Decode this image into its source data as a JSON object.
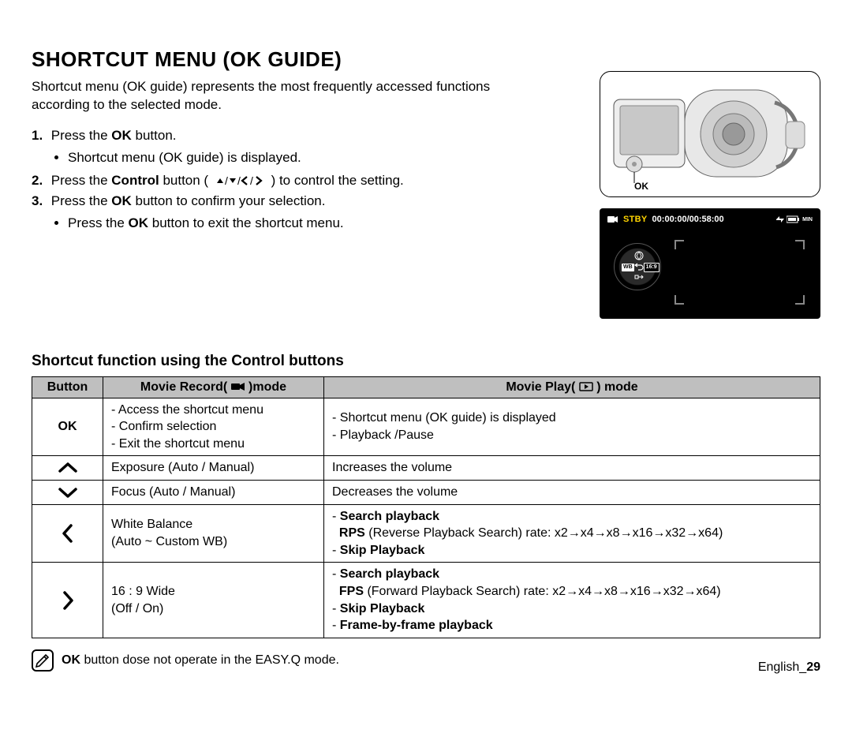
{
  "title": "SHORTCUT MENU (OK GUIDE)",
  "intro": "Shortcut menu (OK guide) represents the most frequently accessed functions according to the selected mode.",
  "steps": {
    "s1_a": "Press the ",
    "s1_bold": "OK",
    "s1_b": " button.",
    "s1_bullet": "Shortcut menu (OK guide) is displayed.",
    "s2_a": "Press the ",
    "s2_bold": "Control ",
    "s2_c": "button (",
    "s2_d": ") to control the setting.",
    "s3_a": "Press the ",
    "s3_bold": "OK",
    "s3_b": " button to confirm your selection.",
    "s3_bullet_a": "Press the ",
    "s3_bullet_bold": "OK",
    "s3_bullet_b": " button to exit the shortcut menu."
  },
  "illus": {
    "ok_label": "OK",
    "stby": "STBY",
    "time": "00:00:00/00:58:00",
    "wb": "WB",
    "ratio": "16:9",
    "min": "MIN"
  },
  "subhead": "Shortcut function using the Control buttons",
  "table": {
    "headers": {
      "button": "Button",
      "record": "Movie Record(      )mode",
      "play": "Movie Play(      ) mode"
    },
    "rows": {
      "ok": {
        "btn": "OK",
        "rec_l1": "- Access the shortcut menu",
        "rec_l2": "- Confirm selection",
        "rec_l3": "- Exit the shortcut menu",
        "play_l1": "- Shortcut menu (OK guide)  is displayed",
        "play_l2": "- Playback /Pause"
      },
      "up": {
        "rec": "Exposure (Auto / Manual)",
        "play": "Increases the volume"
      },
      "down": {
        "rec": "Focus (Auto / Manual)",
        "play": "Decreases the volume"
      },
      "left": {
        "rec_l1": "White Balance",
        "rec_l2": "(Auto ~ Custom WB)",
        "play_b1": "Search playback",
        "play_l2a": "RPS ",
        "play_l2b": "(Reverse Playback Search) rate: x2→x4→x8→x16→x32→x64)",
        "play_b3": "Skip Playback"
      },
      "right": {
        "rec_l1": "16 : 9 Wide",
        "rec_l2": " (Off / On)",
        "play_b1": "Search playback",
        "play_l2a": "FPS ",
        "play_l2b": "(Forward Playback Search) rate: x2→x4→x8→x16→x32→x64)",
        "play_b3": "Skip Playback",
        "play_b4": "Frame-by-frame playback"
      }
    }
  },
  "note": {
    "bold": "OK",
    "text": " button dose not operate in the EASY.Q mode."
  },
  "footer": {
    "lang": "English_",
    "page": "29"
  }
}
